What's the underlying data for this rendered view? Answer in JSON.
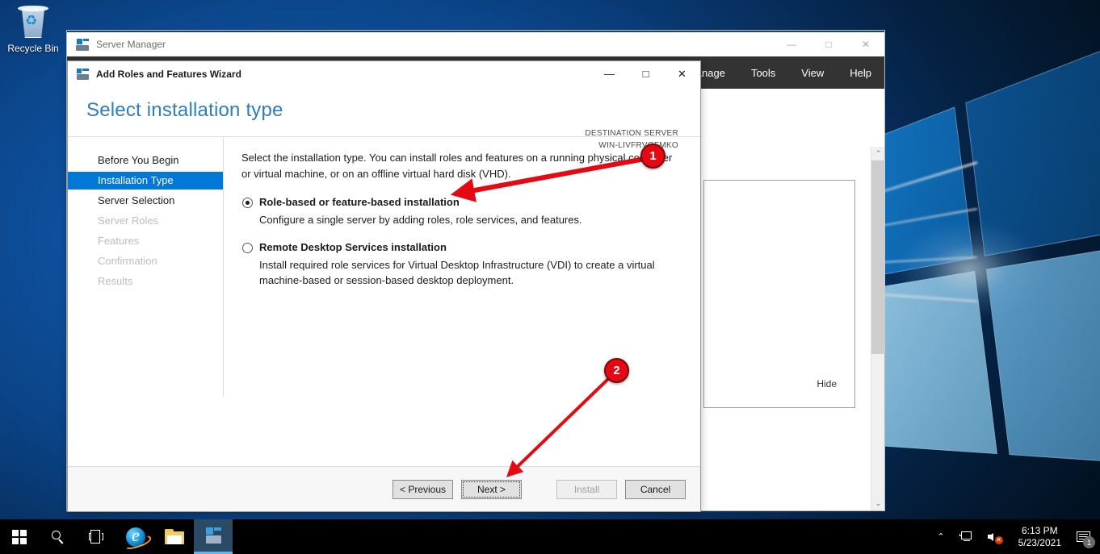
{
  "desktop": {
    "recycle_bin": {
      "label": "Recycle Bin",
      "icon": "recycle-bin-icon"
    }
  },
  "server_manager": {
    "title": "Server Manager",
    "icon": "server-manager-icon",
    "window_controls": {
      "minimize": "—",
      "maximize": "□",
      "close": "✕"
    },
    "menu": [
      {
        "label": "Manage"
      },
      {
        "label": "Tools"
      },
      {
        "label": "View"
      },
      {
        "label": "Help"
      }
    ],
    "panel_hide_link": "Hide",
    "scroll_up": "⌃",
    "scroll_down": "⌄"
  },
  "wizard": {
    "title": "Add Roles and Features Wizard",
    "icon": "wizard-icon",
    "window_controls": {
      "minimize": "—",
      "maximize": "□",
      "close": "✕"
    },
    "page_title": "Select installation type",
    "destination": {
      "caption": "DESTINATION SERVER",
      "server": "WIN-LIVFRVQFMKO"
    },
    "nav": [
      {
        "label": "Before You Begin",
        "state": "enabled"
      },
      {
        "label": "Installation Type",
        "state": "selected"
      },
      {
        "label": "Server Selection",
        "state": "enabled"
      },
      {
        "label": "Server Roles",
        "state": "disabled"
      },
      {
        "label": "Features",
        "state": "disabled"
      },
      {
        "label": "Confirmation",
        "state": "disabled"
      },
      {
        "label": "Results",
        "state": "disabled"
      }
    ],
    "intro": "Select the installation type. You can install roles and features on a running physical computer or virtual machine, or on an offline virtual hard disk (VHD).",
    "options": [
      {
        "title": "Role-based or feature-based installation",
        "description": "Configure a single server by adding roles, role services, and features.",
        "selected": true
      },
      {
        "title": "Remote Desktop Services installation",
        "description": "Install required role services for Virtual Desktop Infrastructure (VDI) to create a virtual machine-based or session-based desktop deployment.",
        "selected": false
      }
    ],
    "buttons": {
      "previous": "< Previous",
      "next": "Next >",
      "install": "Install",
      "cancel": "Cancel"
    }
  },
  "annotations": [
    {
      "number": "1",
      "color": "#e50914"
    },
    {
      "number": "2",
      "color": "#e50914"
    }
  ],
  "taskbar": {
    "items": [
      {
        "name": "start-button",
        "icon": "windows-logo-icon"
      },
      {
        "name": "search-button",
        "icon": "search-icon"
      },
      {
        "name": "task-view-button",
        "icon": "task-view-icon"
      },
      {
        "name": "internet-explorer-button",
        "icon": "internet-explorer-icon"
      },
      {
        "name": "file-explorer-button",
        "icon": "folder-icon"
      },
      {
        "name": "server-manager-taskbar-button",
        "icon": "server-manager-icon"
      }
    ],
    "tray": {
      "show_hidden": "⌃",
      "network_icon": "network-icon",
      "volume_icon": "volume-muted-icon",
      "time": "6:13 PM",
      "date": "5/23/2021",
      "notification_count": "1"
    }
  }
}
